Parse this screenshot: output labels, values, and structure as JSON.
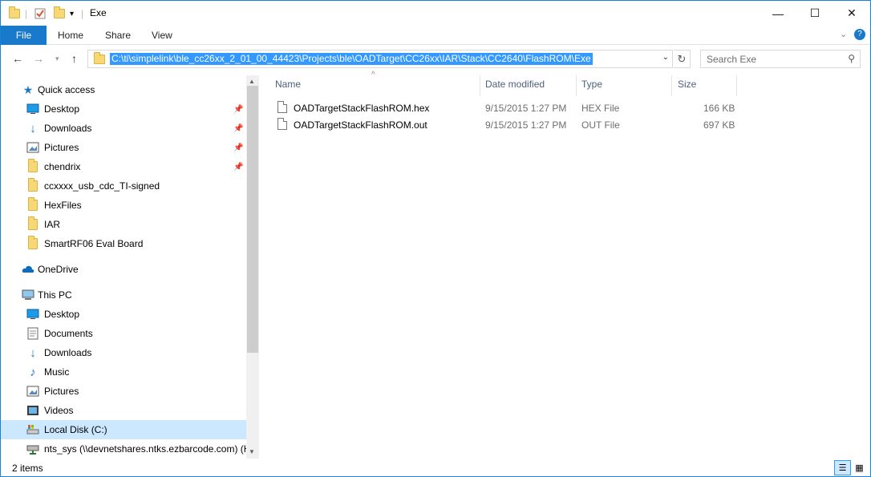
{
  "window": {
    "title": "Exe"
  },
  "ribbon": {
    "tabs": [
      "File",
      "Home",
      "Share",
      "View"
    ]
  },
  "address": {
    "path": "C:\\ti\\simplelink\\ble_cc26xx_2_01_00_44423\\Projects\\ble\\OADTarget\\CC26xx\\IAR\\Stack\\CC2640\\FlashROM\\Exe",
    "search_placeholder": "Search Exe"
  },
  "nav": {
    "quick_access": "Quick access",
    "quick_items": [
      "Desktop",
      "Downloads",
      "Pictures",
      "chendrix",
      "ccxxxx_usb_cdc_TI-signed",
      "HexFiles",
      "IAR",
      "SmartRF06 Eval Board"
    ],
    "onedrive": "OneDrive",
    "this_pc": "This PC",
    "pc_items": [
      "Desktop",
      "Documents",
      "Downloads",
      "Music",
      "Pictures",
      "Videos",
      "Local Disk (C:)",
      "nts_sys (\\\\devnetshares.ntks.ezbarcode.com) (H"
    ]
  },
  "columns": {
    "name": "Name",
    "date": "Date modified",
    "type": "Type",
    "size": "Size"
  },
  "files": [
    {
      "name": "OADTargetStackFlashROM.hex",
      "date": "9/15/2015 1:27 PM",
      "type": "HEX File",
      "size": "166 KB"
    },
    {
      "name": "OADTargetStackFlashROM.out",
      "date": "9/15/2015 1:27 PM",
      "type": "OUT File",
      "size": "697 KB"
    }
  ],
  "status": {
    "items": "2 items"
  },
  "colors": {
    "accent": "#1979ca",
    "selection": "#cce8ff",
    "header_text": "#4c607a"
  }
}
